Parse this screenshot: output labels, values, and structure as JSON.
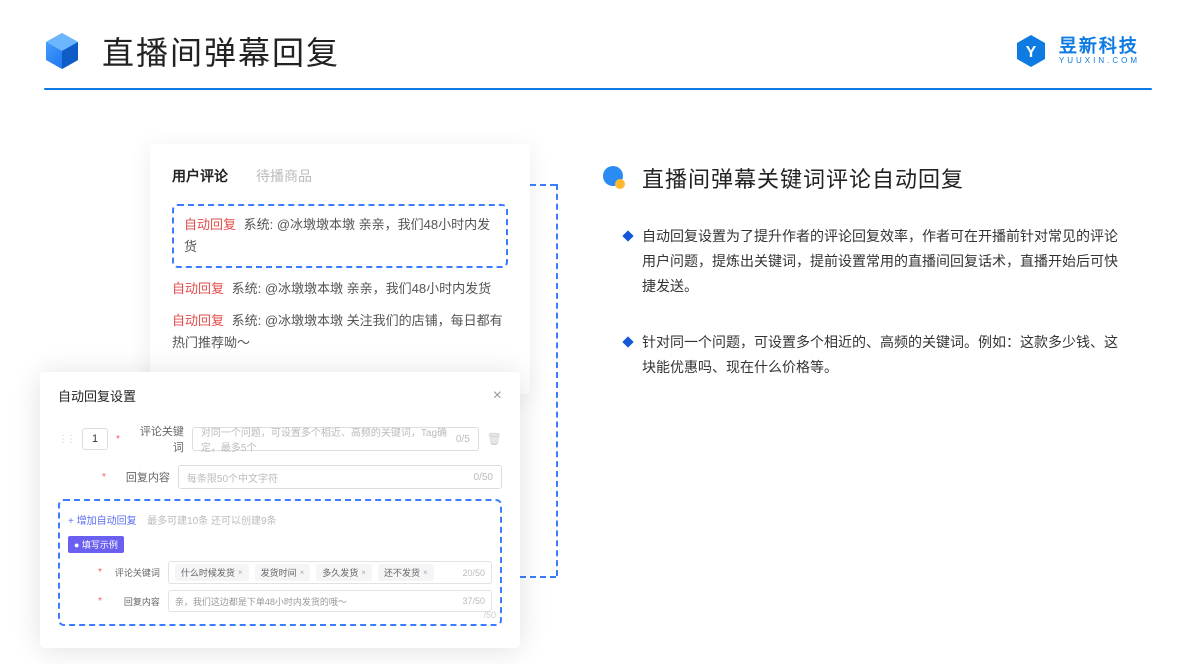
{
  "header": {
    "title": "直播间弹幕回复"
  },
  "brand": {
    "name": "昱新科技",
    "sub": "YUUXIN.COM"
  },
  "comments": {
    "tab_active": "用户评论",
    "tab_inactive": "待播商品",
    "badge": "自动回复",
    "row1_prefix": "系统: @冰墩墩本墩 亲亲，我们48小时内发货",
    "row2": "系统: @冰墩墩本墩 亲亲，我们48小时内发货",
    "row3": "系统: @冰墩墩本墩 关注我们的店铺，每日都有热门推荐呦～"
  },
  "settings": {
    "title": "自动回复设置",
    "num": "1",
    "label_keyword": "评论关键词",
    "placeholder_keyword": "对同一个问题，可设置多个相近、高频的关键词，Tag确定，最多5个",
    "count_keyword": "0/5",
    "label_content": "回复内容",
    "placeholder_content": "每条限50个中文字符",
    "count_content": "0/50",
    "add_link": "+ 增加自动回复",
    "add_hint": "最多可建10条 还可以创建9条",
    "example_badge": "● 填写示例",
    "ex_label_kw": "评论关键词",
    "ex_tags": [
      "什么时候发货",
      "发货时间",
      "多久发货",
      "还不发货"
    ],
    "ex_kw_count": "20/50",
    "ex_label_ct": "回复内容",
    "ex_content_text": "亲，我们这边都是下单48小时内发货的哦～",
    "ex_ct_count": "37/50",
    "extra": "/50"
  },
  "right": {
    "title": "直播间弹幕关键词评论自动回复",
    "p1": "自动回复设置为了提升作者的评论回复效率，作者可在开播前针对常见的评论用户问题，提炼出关键词，提前设置常用的直播间回复话术，直播开始后可快捷发送。",
    "p2": "针对同一个问题，可设置多个相近的、高频的关键词。例如：这款多少钱、这块能优惠吗、现在什么价格等。"
  }
}
